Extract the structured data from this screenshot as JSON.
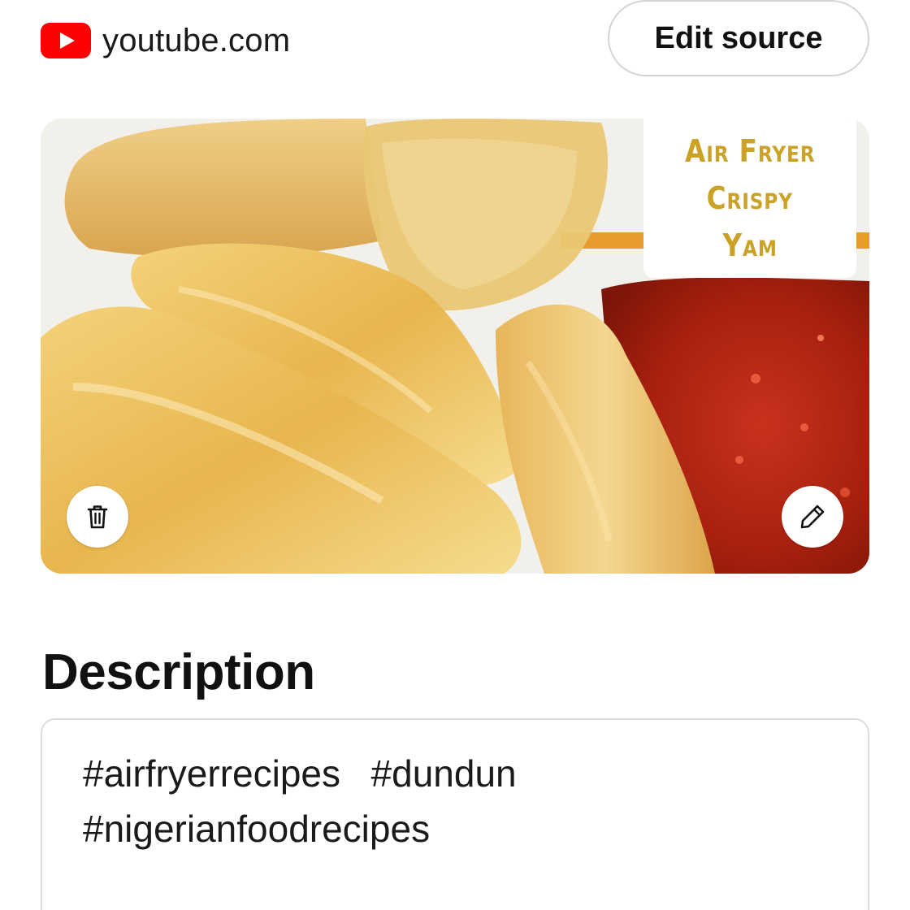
{
  "source": {
    "icon": "youtube-logo-icon",
    "domain": "youtube.com",
    "edit_label": "Edit source"
  },
  "image": {
    "overlay_title": {
      "lines": [
        "Air Fryer",
        "Crispy",
        "Yam"
      ]
    },
    "delete_icon": "trash-icon",
    "edit_icon": "pencil-icon"
  },
  "description": {
    "heading": "Description",
    "text": "#airfryerrecipes  #dundun\n#nigerianfoodrecipes"
  },
  "colors": {
    "youtube_red": "#ff0000",
    "overlay_title": "#c9a227",
    "button_border": "#d4d4d4",
    "box_border": "#dcdcdc"
  }
}
